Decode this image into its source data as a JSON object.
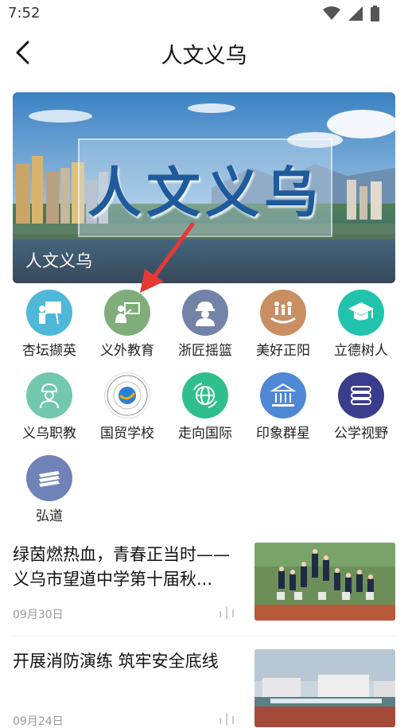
{
  "status_bar": {
    "time": "7:52"
  },
  "nav": {
    "title": "人文义乌"
  },
  "banner": {
    "calligraphy": "人文义乌",
    "caption": "人文义乌"
  },
  "categories": [
    {
      "label": "杏坛撷英",
      "icon": "teacher-icon",
      "color": "#4fb8d8"
    },
    {
      "label": "义外教育",
      "icon": "presenter-icon",
      "color": "#7fae7b"
    },
    {
      "label": "浙匠摇篮",
      "icon": "worker-icon",
      "color": "#7383a8"
    },
    {
      "label": "美好正阳",
      "icon": "family-icon",
      "color": "#c98f62"
    },
    {
      "label": "立德树人",
      "icon": "graduation-cap-icon",
      "color": "#22c3ad"
    },
    {
      "label": "义乌职教",
      "icon": "engineer-icon",
      "color": "#71c8ad"
    },
    {
      "label": "国贸学校",
      "icon": "school-emblem-icon",
      "color": "#ffffff"
    },
    {
      "label": "走向国际",
      "icon": "globe-icon",
      "color": "#2fbf8a"
    },
    {
      "label": "印象群星",
      "icon": "building-icon",
      "color": "#4f88d4"
    },
    {
      "label": "公学视野",
      "icon": "books-icon",
      "color": "#3a3c8c"
    },
    {
      "label": "弘道",
      "icon": "stacked-books-icon",
      "color": "#7083b8"
    }
  ],
  "news": [
    {
      "title": "绿茵燃热血，青春正当时——义乌市望道中学第十届秋...",
      "date": "09月30日"
    },
    {
      "title": "开展消防演练 筑牢安全底线",
      "date": "09月24日"
    }
  ]
}
